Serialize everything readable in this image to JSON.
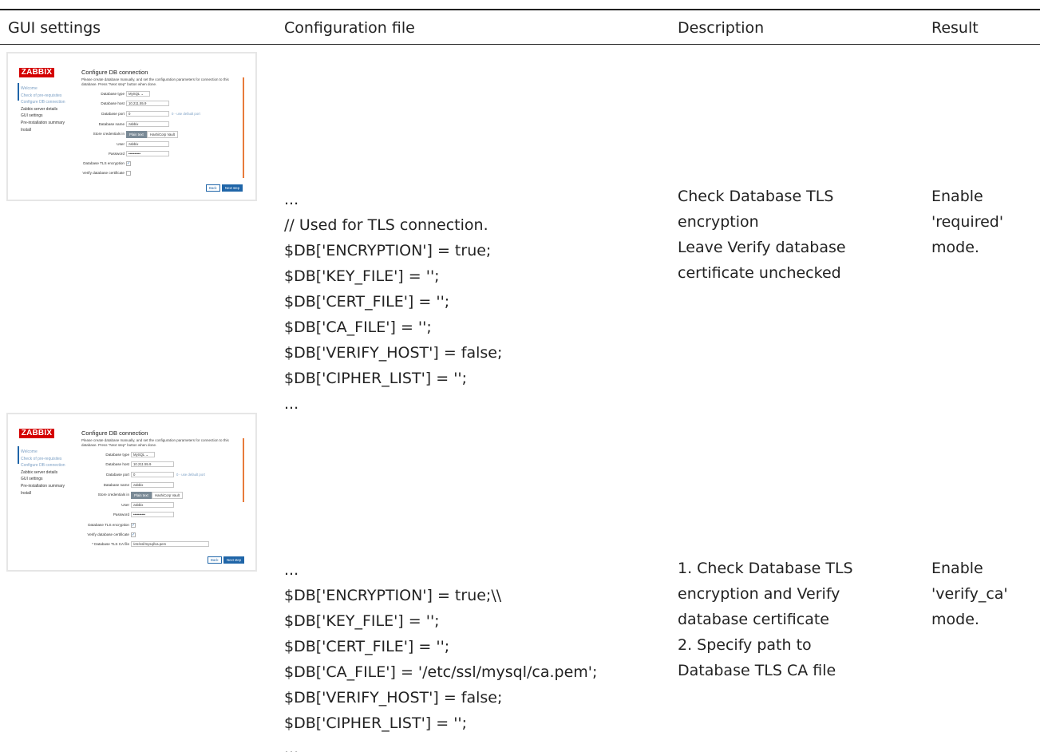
{
  "table": {
    "headers": [
      "GUI settings",
      "Configuration file",
      "Description",
      "Result"
    ],
    "rows": [
      {
        "config_lines": [
          "...",
          "// Used for TLS connection.",
          "$DB['ENCRYPTION'] = true;",
          "$DB['KEY_FILE'] = '';",
          "$DB['CERT_FILE'] = '';",
          "$DB['CA_FILE'] = '';",
          "$DB['VERIFY_HOST'] = false;",
          "$DB['CIPHER_LIST'] = '';",
          "..."
        ],
        "description_lines": [
          "Check Database TLS",
          "encryption",
          "Leave Verify database",
          "certificate unchecked"
        ],
        "result_lines": [
          "Enable",
          "'required'",
          "mode."
        ]
      },
      {
        "config_lines": [
          "...",
          "$DB['ENCRYPTION'] = true;\\\\",
          "$DB['KEY_FILE'] = '';",
          "$DB['CERT_FILE'] = '';",
          "$DB['CA_FILE'] = '/etc/ssl/mysql/ca.pem';",
          "$DB['VERIFY_HOST'] = false;",
          "$DB['CIPHER_LIST'] = '';",
          "..."
        ],
        "description_lines": [
          "1. Check Database TLS",
          "encryption and Verify",
          "database certificate",
          "2. Specify path to",
          "Database TLS CA file"
        ],
        "result_lines": [
          "Enable",
          "'verify_ca'",
          "mode."
        ]
      }
    ]
  },
  "screenshots": [
    {
      "logo": "ZABBIX",
      "nav": [
        "Welcome",
        "Check of pre-requisites",
        "Configure DB connection",
        "Zabbix server details",
        "GUI settings",
        "Pre-installation summary",
        "Install"
      ],
      "title": "Configure DB connection",
      "intro": "Please create database manually, and set the configuration parameters for connection to this database. Press \"Next step\" button when done.",
      "labels": {
        "db_type": "Database type",
        "db_host": "Database host",
        "db_port": "Database port",
        "db_name": "Database name",
        "store": "Store credentials in",
        "user": "User",
        "password": "Password",
        "tls": "Database TLS encryption",
        "verify": "Verify database certificate"
      },
      "values": {
        "db_type": "MySQL",
        "db_host": "10.211.55.9",
        "db_port": "0",
        "port_hint": "0 - use default port",
        "db_name": "zabbix",
        "store_plain": "Plain text",
        "store_vault": "HashiCorp Vault",
        "user": "zabbix",
        "password": "••••••••••"
      },
      "tls_checked": true,
      "verify_checked": false,
      "back": "Back",
      "next": "Next step"
    },
    {
      "logo": "ZABBIX",
      "nav": [
        "Welcome",
        "Check of pre-requisites",
        "Configure DB connection",
        "Zabbix server details",
        "GUI settings",
        "Pre-installation summary",
        "Install"
      ],
      "title": "Configure DB connection",
      "intro": "Please create database manually, and set the configuration parameters for connection to this database. Press \"Next step\" button when done.",
      "labels": {
        "db_type": "Database type",
        "db_host": "Database host",
        "db_port": "Database port",
        "db_name": "Database name",
        "store": "Store credentials in",
        "user": "User",
        "password": "Password",
        "tls": "Database TLS encryption",
        "verify": "Verify database certificate",
        "ca_file": "* Database TLS CA file"
      },
      "values": {
        "db_type": "MySQL",
        "db_host": "10.211.55.9",
        "db_port": "0",
        "port_hint": "0 - use default port",
        "db_name": "zabbix",
        "store_plain": "Plain text",
        "store_vault": "HashiCorp Vault",
        "user": "zabbix",
        "password": "••••••••••",
        "ca_file": "/etc/ssl/mysql/ca.pem"
      },
      "tls_checked": true,
      "verify_checked": true,
      "back": "Back",
      "next": "Next step"
    }
  ]
}
